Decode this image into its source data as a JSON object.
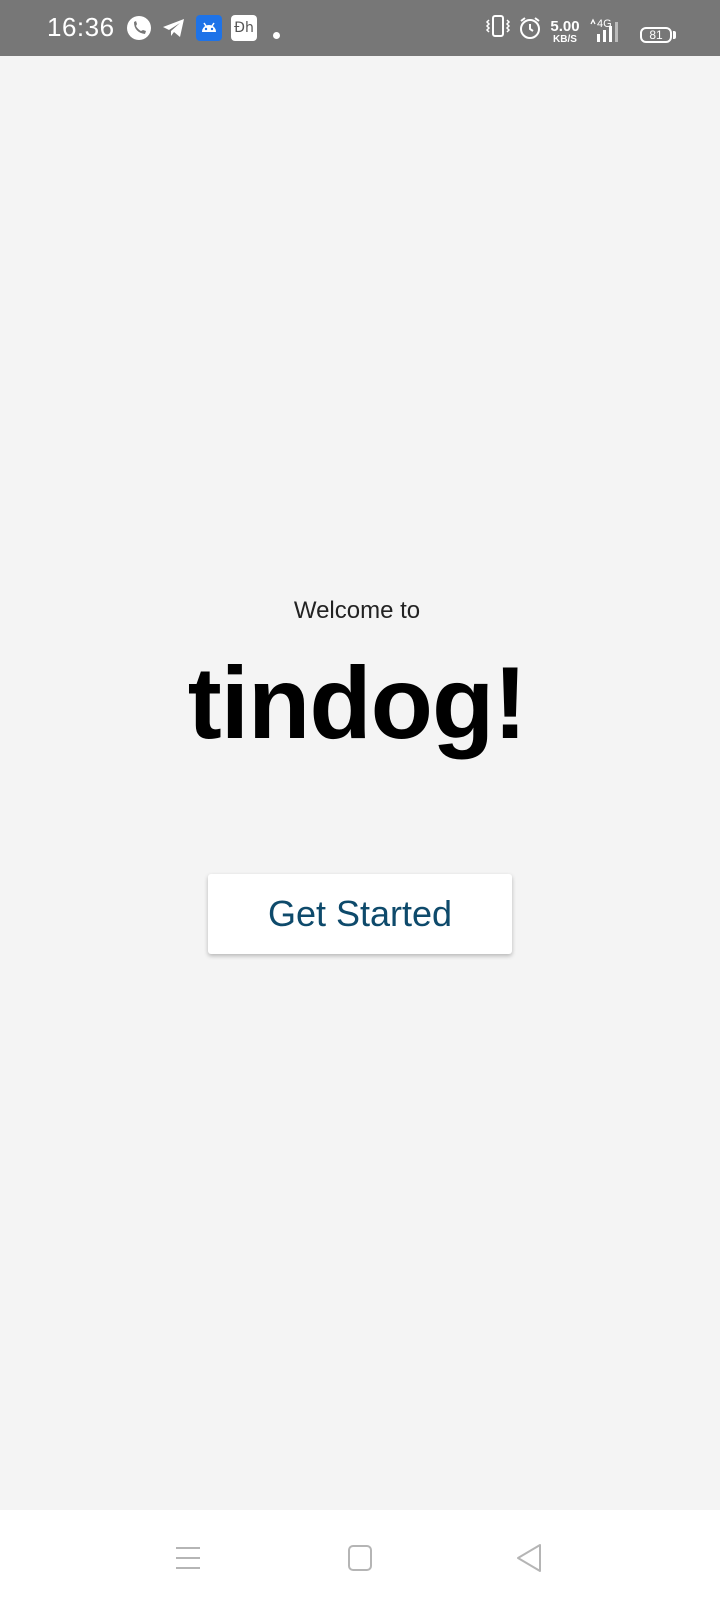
{
  "status_bar": {
    "time": "16:36",
    "icons_left": [
      "phone-icon",
      "telegram-icon",
      "android-icon",
      "dh-app-icon",
      "notification-dot-icon"
    ],
    "icons_right": [
      "vibrate-icon",
      "alarm-icon",
      "network-speed",
      "4g-signal-icon",
      "battery-icon"
    ],
    "dh_label": "Ðh",
    "net_speed_value": "5.00",
    "net_speed_unit": "KB/S",
    "network_type": "4G",
    "battery_level": "81"
  },
  "main": {
    "welcome_text": "Welcome to",
    "app_name": "tindog!",
    "cta_label": "Get Started"
  },
  "nav_bar": {
    "buttons": [
      "menu-icon",
      "home-icon",
      "back-icon"
    ]
  },
  "colors": {
    "status_bar_bg": "#777777",
    "page_bg": "#f4f4f4",
    "cta_text": "#0e4a6b",
    "app_name_text": "#000000"
  }
}
